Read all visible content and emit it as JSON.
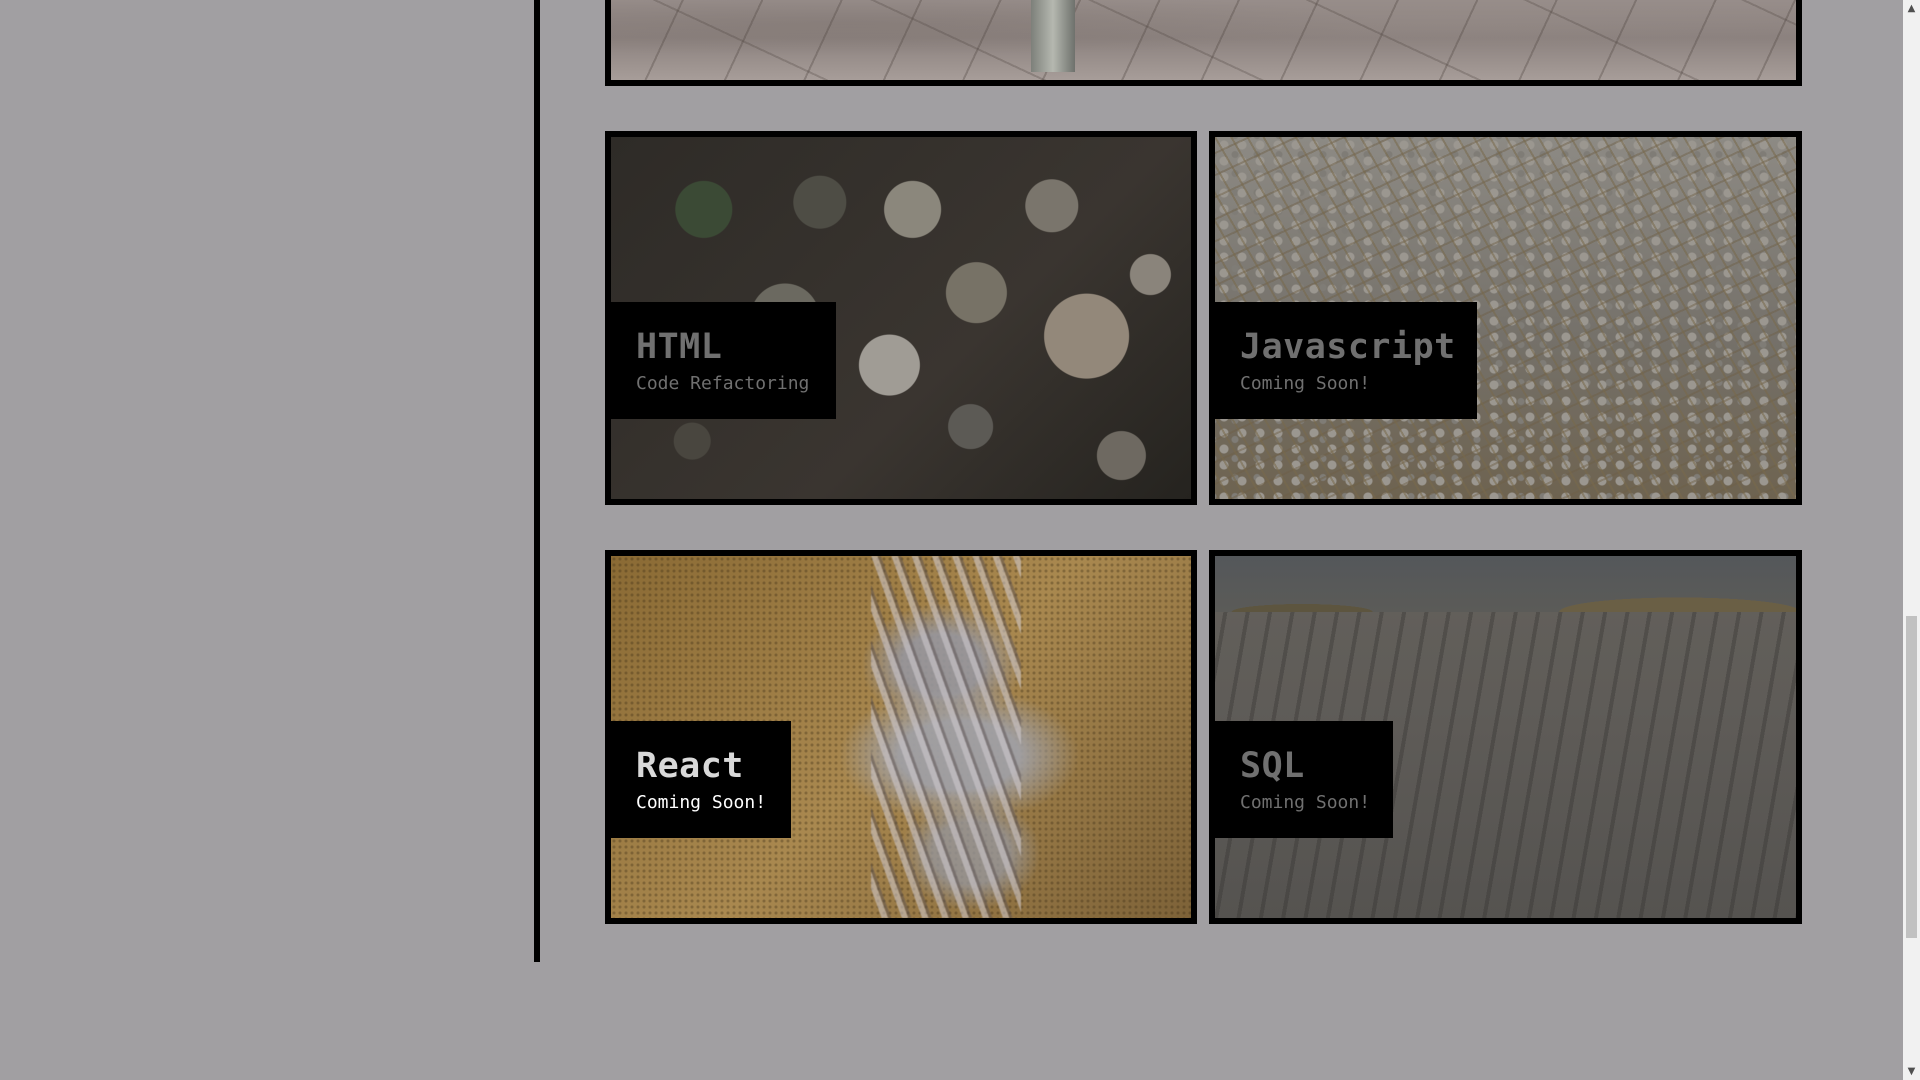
{
  "projects": [
    {
      "title": "HTML",
      "subtitle": "Code Refactoring"
    },
    {
      "title": "Javascript",
      "subtitle": "Coming Soon!"
    },
    {
      "title": "React",
      "subtitle": "Coming Soon!"
    },
    {
      "title": "SQL",
      "subtitle": "Coming Soon!"
    }
  ],
  "scrollbar": {
    "up_icon": "chevron-up-icon",
    "down_icon": "chevron-down-icon",
    "position_fraction": 0.95
  },
  "colors": {
    "page_background": "#a19fa2",
    "border": "#000000",
    "label_background": "#000000"
  }
}
